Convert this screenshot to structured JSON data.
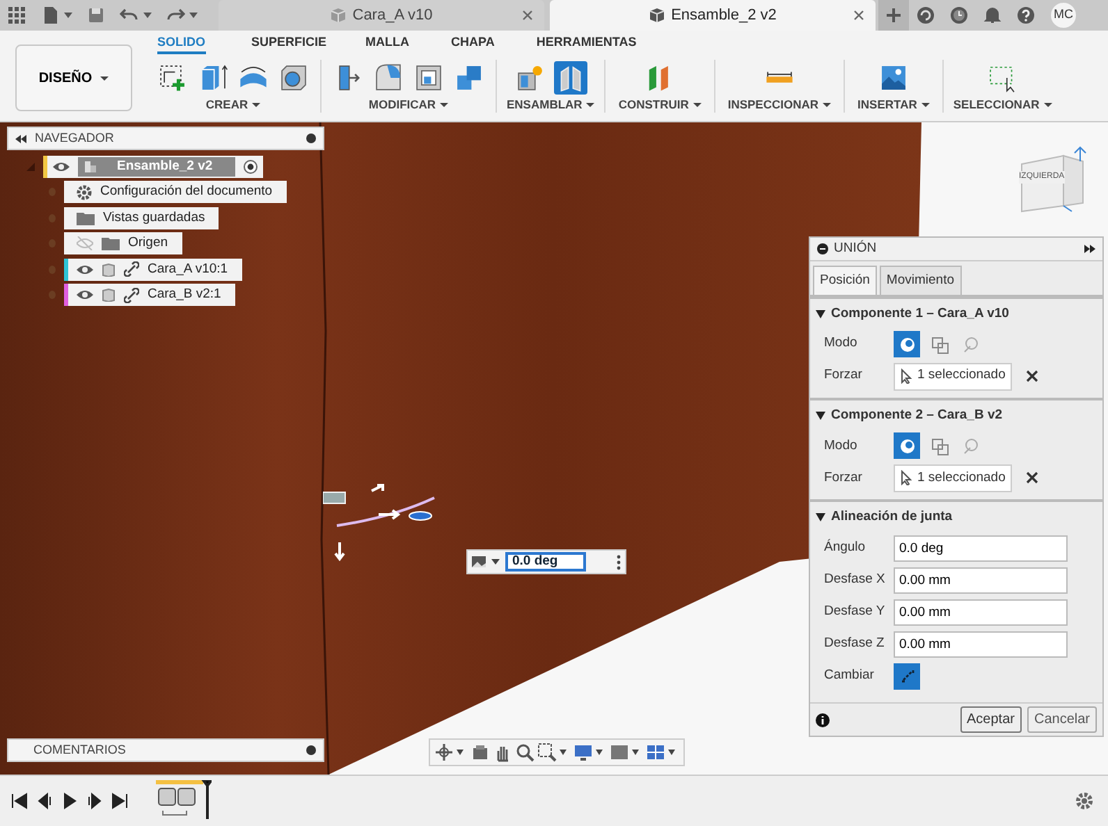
{
  "document_tabs": [
    {
      "title": "Cara_A v10",
      "selected": false
    },
    {
      "title": "Ensamble_2 v2",
      "selected": true
    }
  ],
  "user_initials": "MC",
  "workspace": "DISEÑO",
  "toolbar_tabs": [
    {
      "label": "SOLIDO",
      "selected": true
    },
    {
      "label": "SUPERFICIE",
      "selected": false
    },
    {
      "label": "MALLA",
      "selected": false
    },
    {
      "label": "CHAPA",
      "selected": false
    },
    {
      "label": "HERRAMIENTAS",
      "selected": false
    }
  ],
  "tool_groups": [
    {
      "label": "CREAR",
      "tools": [
        {
          "kind": "sketch",
          "selected": false
        },
        {
          "kind": "extrude",
          "selected": false
        },
        {
          "kind": "revolve",
          "selected": false
        },
        {
          "kind": "hole",
          "selected": false
        }
      ]
    },
    {
      "label": "MODIFICAR",
      "tools": [
        {
          "kind": "presspull",
          "selected": false
        },
        {
          "kind": "fillet",
          "selected": false
        },
        {
          "kind": "shell",
          "selected": false
        },
        {
          "kind": "combine",
          "selected": false
        }
      ]
    },
    {
      "label": "ENSAMBLAR",
      "tools": [
        {
          "kind": "newcomponent",
          "selected": false
        },
        {
          "kind": "joint",
          "selected": true
        }
      ]
    },
    {
      "label": "CONSTRUIR",
      "tools": [
        {
          "kind": "plane",
          "selected": false
        }
      ]
    },
    {
      "label": "INSPECCIONAR",
      "tools": [
        {
          "kind": "measure",
          "selected": false
        }
      ]
    },
    {
      "label": "INSERTAR",
      "tools": [
        {
          "kind": "image",
          "selected": false
        }
      ]
    },
    {
      "label": "SELECCIONAR",
      "tools": [
        {
          "kind": "select",
          "selected": false
        }
      ]
    }
  ],
  "navigator": {
    "title": "NAVEGADOR",
    "items": [
      {
        "label": "Ensamble_2 v2",
        "kind": "root",
        "color": "#f2c744",
        "visible": true,
        "children": [
          {
            "label": "Configuración del documento",
            "kind": "settings"
          },
          {
            "label": "Vistas guardadas",
            "kind": "folder"
          },
          {
            "label": "Origen",
            "kind": "folder",
            "visible": false
          },
          {
            "label": "Cara_A v10:1",
            "kind": "component",
            "color": "#2ec4d6",
            "visible": true
          },
          {
            "label": "Cara_B v2:1",
            "kind": "component",
            "color": "#e05fe0",
            "visible": true
          }
        ]
      }
    ]
  },
  "viewcube": {
    "label": "IZQUIERDA"
  },
  "joint_widget": {
    "value": "0.0 deg"
  },
  "comments": {
    "title": "COMENTARIOS"
  },
  "union_panel": {
    "title": "UNIÓN",
    "tabs": [
      {
        "label": "Posición",
        "selected": true
      },
      {
        "label": "Movimiento",
        "selected": false
      }
    ],
    "sections": [
      {
        "title": "Componente 1 – Cara_A v10",
        "expanded": true,
        "rows": [
          {
            "kind": "mode",
            "label": "Modo",
            "modes": [
              {
                "selected": true
              },
              {
                "selected": false
              },
              {
                "selected": false
              }
            ]
          },
          {
            "kind": "select",
            "label": "Forzar",
            "value": "1 seleccionado"
          }
        ]
      },
      {
        "title": "Componente 2 – Cara_B v2",
        "expanded": true,
        "rows": [
          {
            "kind": "mode",
            "label": "Modo",
            "modes": [
              {
                "selected": true
              },
              {
                "selected": false
              },
              {
                "selected": false
              }
            ]
          },
          {
            "kind": "select",
            "label": "Forzar",
            "value": "1 seleccionado"
          }
        ]
      },
      {
        "title": "Alineación de junta",
        "expanded": true,
        "rows": [
          {
            "kind": "input",
            "label": "Ángulo",
            "value": "0.0 deg"
          },
          {
            "kind": "input",
            "label": "Desfase X",
            "value": "0.00 mm"
          },
          {
            "kind": "input",
            "label": "Desfase Y",
            "value": "0.00 mm"
          },
          {
            "kind": "input",
            "label": "Desfase Z",
            "value": "0.00 mm"
          },
          {
            "kind": "flip",
            "label": "Cambiar"
          }
        ]
      }
    ],
    "buttons": [
      {
        "label": "Aceptar",
        "kind": "ok"
      },
      {
        "label": "Cancelar",
        "kind": "cancel"
      }
    ]
  }
}
